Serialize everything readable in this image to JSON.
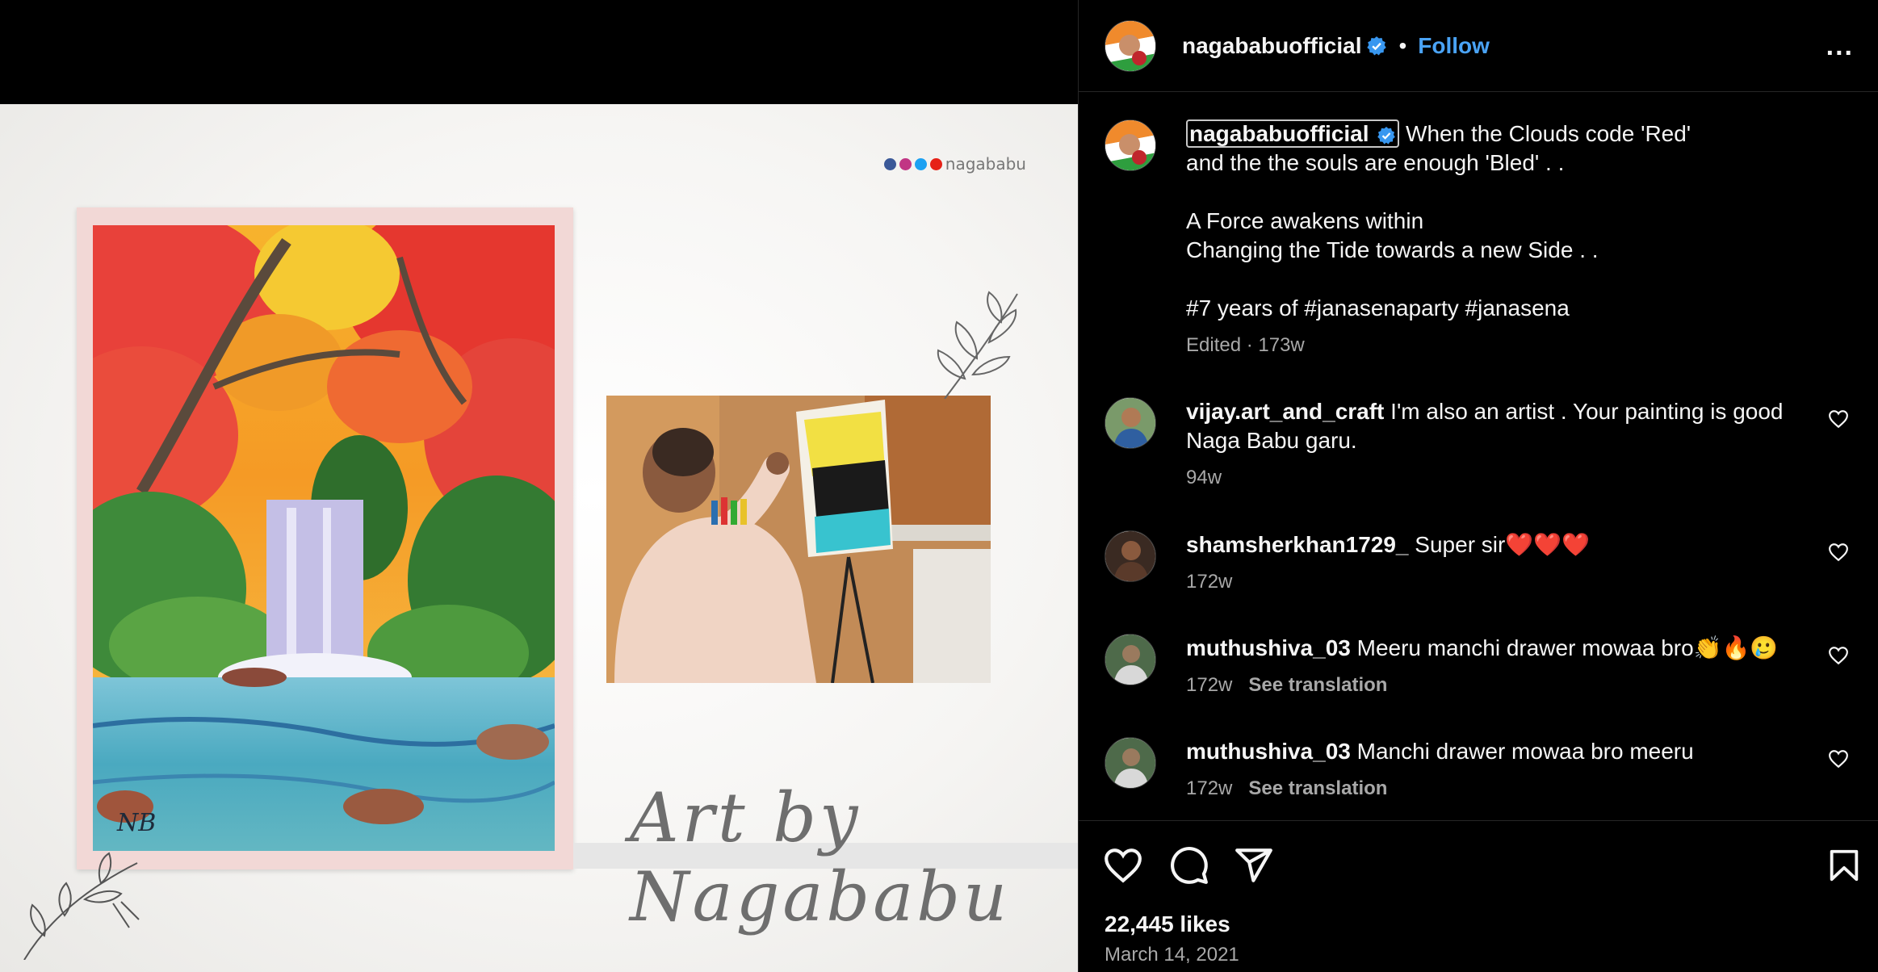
{
  "media": {
    "social_handle": "nagababu",
    "signature_text": "Art by Nagababu",
    "social_icons": [
      "facebook-icon",
      "instagram-icon",
      "twitter-icon",
      "youtube-icon"
    ]
  },
  "header": {
    "username": "nagababuofficial",
    "separator": "•",
    "follow_label": "Follow",
    "more_label": "..."
  },
  "caption": {
    "username": "nagababuofficial",
    "line1": "When the Clouds code 'Red'",
    "line2": "and the the souls are enough 'Bled' . .",
    "line3": "A Force awakens within",
    "line4": "Changing the Tide towards a new Side . .",
    "line5": "#7 years of #janasenaparty #janasena",
    "meta": "Edited · 173w"
  },
  "comments": [
    {
      "username": "vijay.art_and_craft",
      "text": "I'm also an artist . Your painting is good Naga Babu garu.",
      "time": "94w",
      "translation": ""
    },
    {
      "username": "shamsherkhan1729_",
      "text": "Super sir❤️❤️❤️",
      "time": "172w",
      "translation": ""
    },
    {
      "username": "muthushiva_03",
      "text": "Meeru manchi drawer mowaa bro👏🔥🥲",
      "time": "172w",
      "translation": "See translation"
    },
    {
      "username": "muthushiva_03",
      "text": "Manchi drawer mowaa bro meeru",
      "time": "172w",
      "translation": "See translation"
    }
  ],
  "footer": {
    "likes": "22,445 likes",
    "date": "March 14, 2021"
  },
  "colors": {
    "background": "#000000",
    "link_blue": "#4aa3f5",
    "verified_blue": "#3897f0",
    "secondary_text": "#a8a8a8"
  }
}
